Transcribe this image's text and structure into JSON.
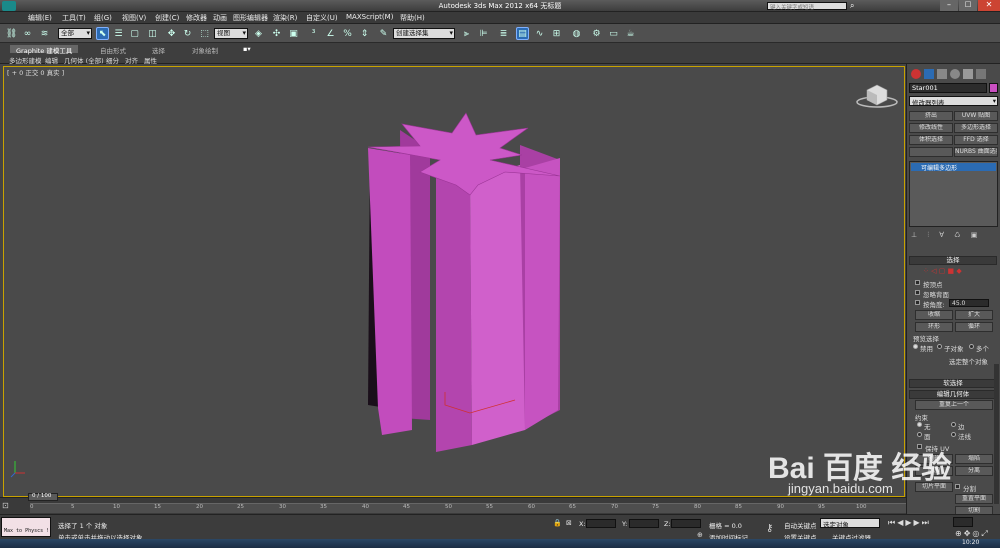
{
  "window": {
    "title": "Autodesk 3ds Max  2012 x64      无标题"
  },
  "search": {
    "placeholder": "键入关键字或短语"
  },
  "menu": [
    "编辑(E)",
    "工具(T)",
    "组(G)",
    "视图(V)",
    "创建(C)",
    "修改器",
    "动画",
    "图形编辑器",
    "渲染(R)",
    "自定义(U)",
    "MAXScript(M)",
    "帮助(H)"
  ],
  "toolbar": {
    "selection_filter": "全部",
    "ref_coord": "视图",
    "named_selection": "创建选择集"
  },
  "ribbon": {
    "tabs": [
      "Graphite 建模工具",
      "自由形式",
      "选择",
      "对象绘制"
    ],
    "sub": [
      "多边形建模",
      "编辑",
      "几何体 (全部)",
      "细分",
      "对齐",
      "属性"
    ]
  },
  "viewport": {
    "label": "[ + 0 正交 0 真实 ]"
  },
  "cmdpanel": {
    "object_name": "Star001",
    "modifier_list": "修改器列表",
    "mod_buttons": [
      "挤出",
      "UVW 贴图",
      "修改线性",
      "多边形选择",
      "体积选择",
      "FFD 选择",
      "",
      "NURBS 曲面选择"
    ],
    "stack_item": "可编辑多边形",
    "rollout_select": "选择",
    "chk_labels": [
      "按顶点",
      "忽略背面",
      "按角度:"
    ],
    "angle_value": "45.0",
    "btn_shrink": "收缩",
    "btn_grow": "扩大",
    "btn_ring": "环形",
    "btn_loop": "循环",
    "preview_label": "预览选择",
    "preview_opts": [
      "禁用",
      "子对象",
      "多个"
    ],
    "select_whole": "选定整个对象",
    "rollout_soft": "软选择",
    "rollout_edit_geo": "编辑几何体",
    "repeat_last": "重复上一个",
    "constraints": "约束",
    "constraint_opts": [
      "无",
      "边",
      "面",
      "法线"
    ],
    "keep_uv": "保持 UV",
    "create": "创建",
    "collapse": "塌陷",
    "attach": "附加",
    "separate": "分离",
    "slice_plane": "切片平面",
    "split": "分割",
    "reset_plane": "重置平面",
    "cut": "切割"
  },
  "timeline": {
    "frame": "0 / 100",
    "ticks": [
      "0",
      "5",
      "10",
      "15",
      "20",
      "25",
      "30",
      "35",
      "40",
      "45",
      "50",
      "55",
      "60",
      "65",
      "70",
      "75",
      "80",
      "85",
      "90",
      "95",
      "100"
    ]
  },
  "status": {
    "script_label": "Max to Physcs !",
    "selected": "选择了 1 个 对象",
    "prompt": "单击或单击并拖动以选择对象",
    "x_label": "X:",
    "y_label": "Y:",
    "z_label": "Z:",
    "grid": "栅格 = 0.0",
    "add_time_tag": "添加时间标记",
    "auto_key": "自动关键点",
    "set_key": "设置关键点",
    "selected_object": "选定对象",
    "key_filters": "关键点过滤器...",
    "clock": "10:20"
  },
  "watermark": {
    "text": "Bai 百度 经验",
    "url": "jingyan.baidu.com"
  },
  "colors": {
    "object": "#c94fc1",
    "object_dark": "#8b2a86",
    "active_blue": "#2b6bb3",
    "viewport_border": "#c8a200"
  }
}
